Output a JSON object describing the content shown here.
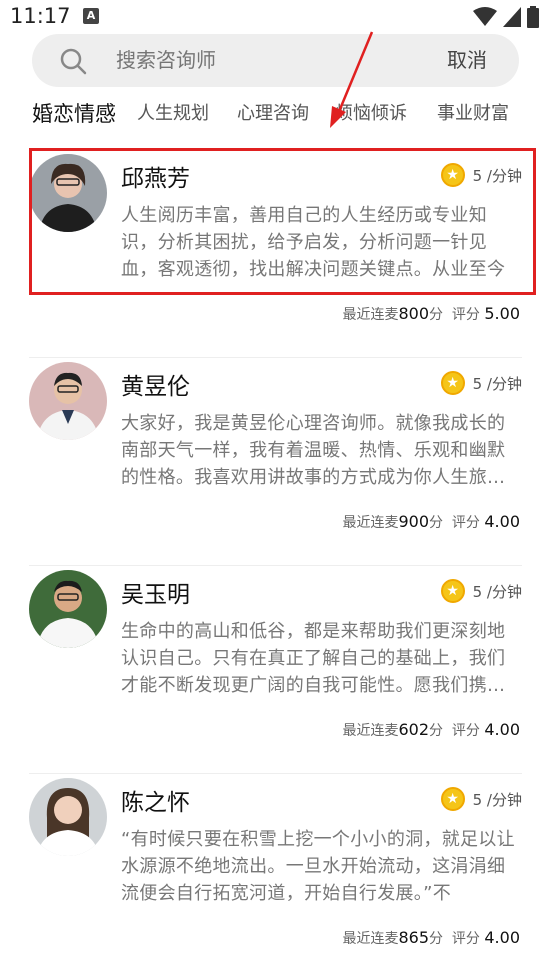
{
  "status_bar": {
    "time": "11:17",
    "indicator": "A"
  },
  "search": {
    "placeholder": "搜索咨询师",
    "cancel_label": "取消"
  },
  "tabs": [
    {
      "label": "婚恋情感",
      "active": true
    },
    {
      "label": "人生规划",
      "active": false
    },
    {
      "label": "心理咨询",
      "active": false
    },
    {
      "label": "烦恼倾诉",
      "active": false
    },
    {
      "label": "事业财富",
      "active": false
    }
  ],
  "consultants": [
    {
      "name": "邱燕芳",
      "rate": "5 /分钟",
      "description": "人生阅历丰富，善用自己的人生经历或专业知识，分析其困扰，给予启发，分析问题一针见血，客观透彻，找出解决问题关键点。从业至今",
      "recent_label": "最近连麦",
      "recent_value": "800",
      "recent_unit": "分",
      "score_label": "评分",
      "score_value": "5.00"
    },
    {
      "name": "黄昱伦",
      "rate": "5 /分钟",
      "description": "大家好，我是黄昱伦心理咨询师。就像我成长的南部天气一样，我有着温暖、热情、乐观和幽默的性格。我喜欢用讲故事的方式成为你人生旅途中",
      "recent_label": "最近连麦",
      "recent_value": "900",
      "recent_unit": "分",
      "score_label": "评分",
      "score_value": "4.00"
    },
    {
      "name": "吴玉明",
      "rate": "5 /分钟",
      "description": "生命中的高山和低谷，都是来帮助我们更深刻地认识自己。只有在真正了解自己的基础上，我们才能不断发现更广阔的自我可能性。愿我们携手同行",
      "recent_label": "最近连麦",
      "recent_value": "602",
      "recent_unit": "分",
      "score_label": "评分",
      "score_value": "4.00"
    },
    {
      "name": "陈之怀",
      "rate": "5 /分钟",
      "description": "“有时候只要在积雪上挖一个小小的洞，就足以让水源源不绝地流出。一旦水开始流动，这涓涓细流便会自行拓宽河道，开始自行发展。”不",
      "recent_label": "最近连麦",
      "recent_value": "865",
      "recent_unit": "分",
      "score_label": "评分",
      "score_value": "4.00"
    }
  ],
  "colors": {
    "highlight": "#e02020",
    "coin": "#f5c518"
  }
}
